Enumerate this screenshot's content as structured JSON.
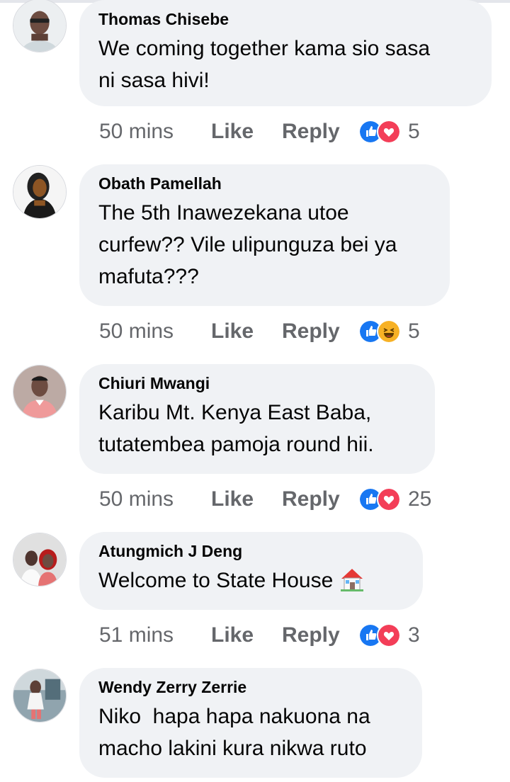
{
  "actions": {
    "like": "Like",
    "reply": "Reply"
  },
  "comments": [
    {
      "author": "Thomas Chisebe",
      "lines": [
        "We coming together kama sio sasa",
        "ni sasa hivi!"
      ],
      "time": "50 mins",
      "reactions": [
        "like-icon",
        "love-icon"
      ],
      "reaction_count": "5"
    },
    {
      "author": "Obath Pamellah",
      "lines": [
        "The 5th Inawezekana utoe",
        "curfew?? Vile ulipunguza bei ya",
        "mafuta???"
      ],
      "time": "50 mins",
      "reactions": [
        "like-icon",
        "haha-icon"
      ],
      "reaction_count": "5"
    },
    {
      "author": "Chiuri Mwangi",
      "lines": [
        "Karibu Mt. Kenya East Baba,",
        "tutatembea pamoja round hii."
      ],
      "time": "50 mins",
      "reactions": [
        "like-icon",
        "love-icon"
      ],
      "reaction_count": "25"
    },
    {
      "author": "Atungmich J Deng",
      "lines": [
        "Welcome to State House"
      ],
      "time": "51 mins",
      "reactions": [
        "like-icon",
        "love-icon"
      ],
      "reaction_count": "3"
    },
    {
      "author": "Wendy Zerry Zerrie",
      "lines": [
        "Niko  hapa hapa nakuona na",
        "macho lakini kura nikwa ruto"
      ]
    }
  ],
  "colors": {
    "bubble": "#f0f2f5",
    "like_blue": "#1877f2",
    "love_red": "#f33e58",
    "haha_yellow": "#f7b125",
    "meta_gray": "#65676b"
  }
}
